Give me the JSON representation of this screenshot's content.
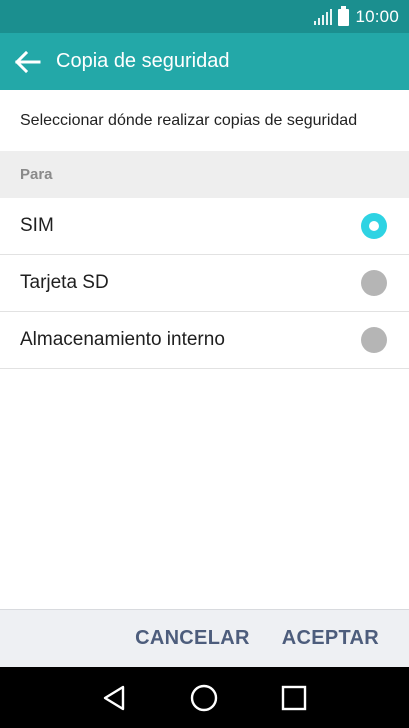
{
  "status_bar": {
    "time": "10:00",
    "icons": [
      "signal-icon",
      "battery-icon"
    ]
  },
  "app_bar": {
    "title": "Copia de seguridad",
    "back_icon": "arrow-left-icon"
  },
  "description": "Seleccionar dónde realizar copias de seguridad",
  "section_header": "Para",
  "options": [
    {
      "label": "SIM",
      "selected": true
    },
    {
      "label": "Tarjeta SD",
      "selected": false
    },
    {
      "label": "Almacenamiento interno",
      "selected": false
    }
  ],
  "buttons": {
    "cancel": "CANCELAR",
    "accept": "ACEPTAR"
  },
  "nav_bar": {
    "icons": [
      "back-triangle-icon",
      "home-circle-icon",
      "recents-square-icon"
    ]
  },
  "colors": {
    "status_bar": "#1b8f8f",
    "app_bar": "#23a8a8",
    "radio_selected": "#2ed3e3",
    "radio_unselected": "#b5b5b5",
    "button_text": "#4d5d7c"
  }
}
